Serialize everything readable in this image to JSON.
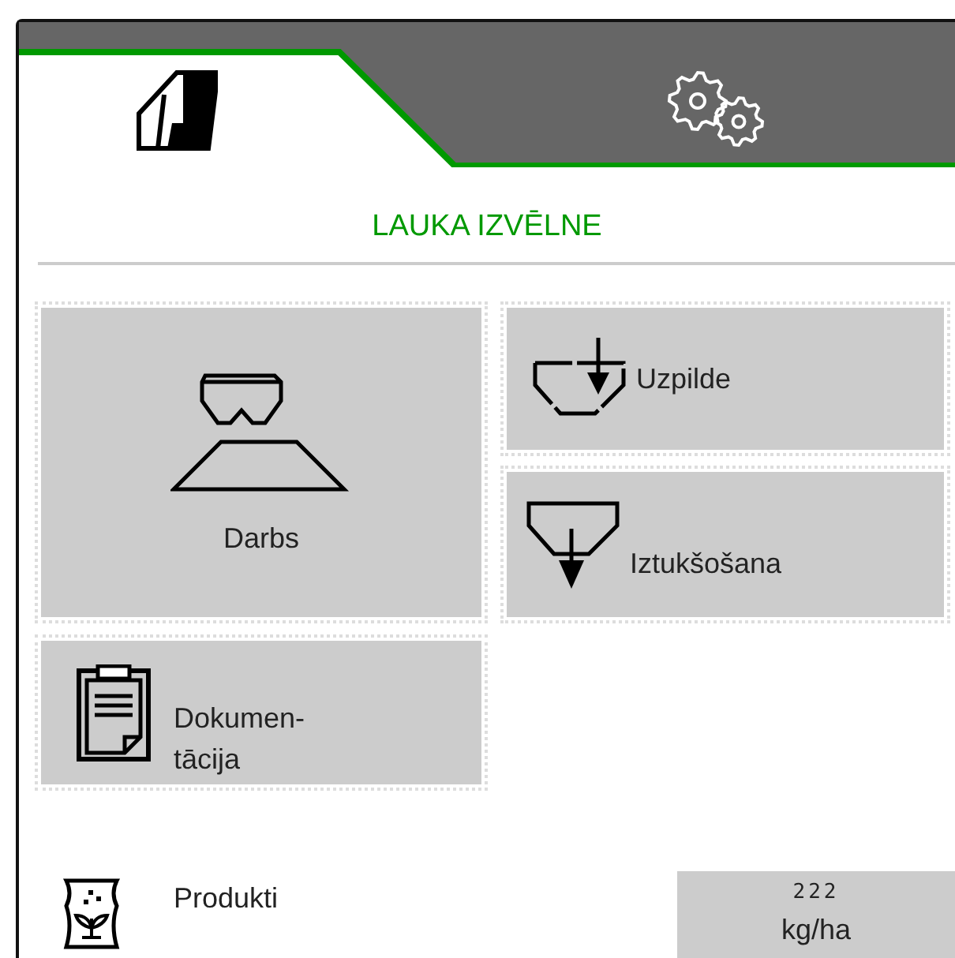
{
  "tabs": [
    {
      "kind": "field",
      "selected": true
    },
    {
      "kind": "settings",
      "selected": false
    }
  ],
  "title": "LAUKA IZVĒLNE",
  "tiles": [
    {
      "kind": "work",
      "label": "Darbs"
    },
    {
      "kind": "fill",
      "label": "Uzpilde"
    },
    {
      "kind": "empty",
      "label": "Iztukšošana"
    },
    {
      "kind": "docs",
      "label": "Dokumen-\ntācija"
    }
  ],
  "product": {
    "label": "Produkti",
    "value": "222",
    "unit": "kg/ha"
  }
}
